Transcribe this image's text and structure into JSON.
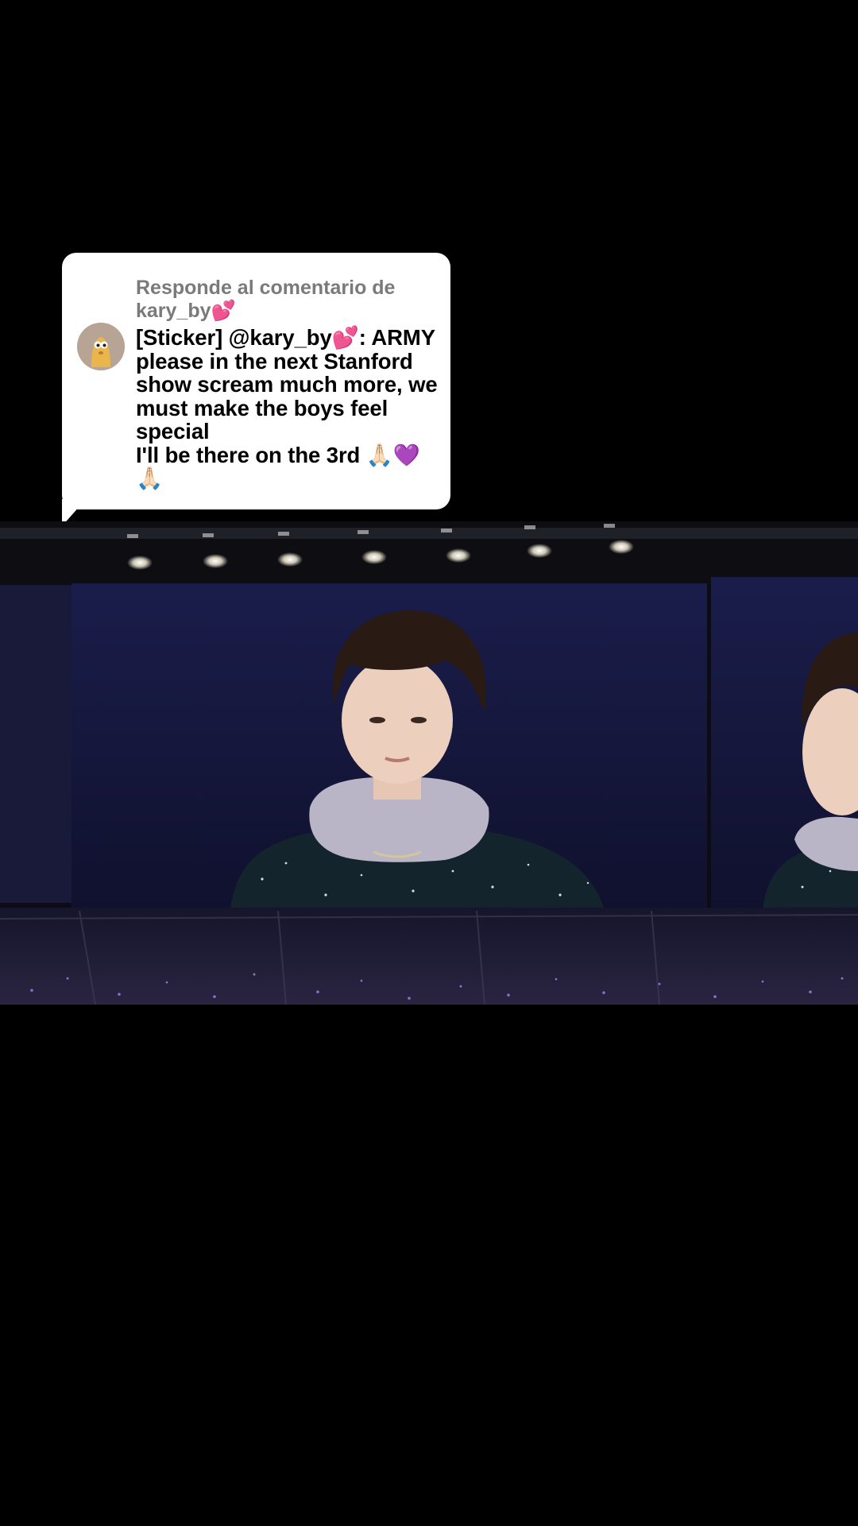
{
  "reply": {
    "header": "Responde al comentario de kary_by💕",
    "body": "[Sticker] @kary_by💕: ARMY please in the next Stanford show scream much more, we must make the boys feel special\nI'll be there on the 3rd 🙏🏻💜🙏🏻"
  },
  "colors": {
    "background": "#000000",
    "bubble": "#ffffff",
    "header_text": "#7a7a7a",
    "body_text": "#000000",
    "avatar_bg": "#b7a495"
  }
}
